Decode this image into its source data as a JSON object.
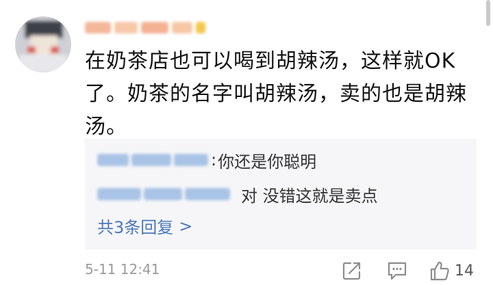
{
  "comment": {
    "text": "在奶茶店也可以喝到胡辣汤，这样就OK了。奶茶的名字叫胡辣汤，卖的也是胡辣汤。"
  },
  "replies": [
    {
      "separator": ":",
      "text": "你还是你聪明"
    },
    {
      "separator": "",
      "text": "对 没错这就是卖点"
    }
  ],
  "more_replies": {
    "label": "共3条回复",
    "arrow": ">"
  },
  "footer": {
    "timestamp": "5-11 12:41",
    "like_count": "14",
    "icons": {
      "share": "share-icon",
      "comment": "comment-icon",
      "like": "thumbs-up-icon"
    }
  },
  "colors": {
    "link_blue": "#4a78b8",
    "reply_bg": "#f6f6f8",
    "meta_gray": "#9a9a9a",
    "text": "#111111"
  }
}
